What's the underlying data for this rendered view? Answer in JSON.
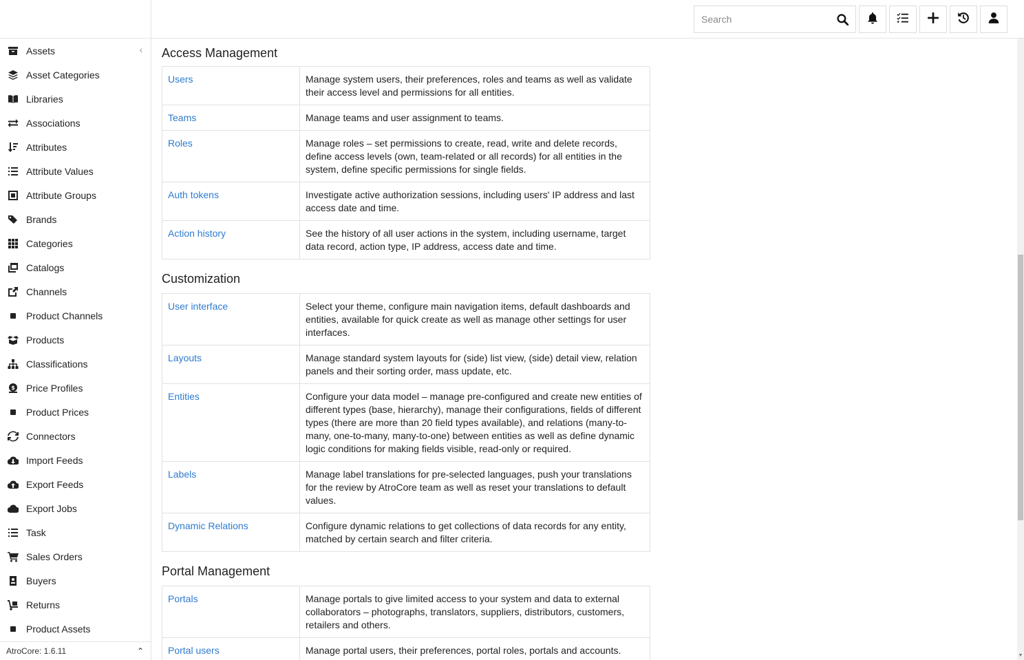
{
  "sidebar": {
    "items": [
      {
        "label": "Assets",
        "icon": "archive-icon"
      },
      {
        "label": "Asset Categories",
        "icon": "layers-icon"
      },
      {
        "label": "Libraries",
        "icon": "book-icon"
      },
      {
        "label": "Associations",
        "icon": "exchange-icon"
      },
      {
        "label": "Attributes",
        "icon": "sort-icon"
      },
      {
        "label": "Attribute Values",
        "icon": "list-icon"
      },
      {
        "label": "Attribute Groups",
        "icon": "group-icon"
      },
      {
        "label": "Brands",
        "icon": "tags-icon"
      },
      {
        "label": "Categories",
        "icon": "grid-icon"
      },
      {
        "label": "Catalogs",
        "icon": "windows-icon"
      },
      {
        "label": "Channels",
        "icon": "share-icon"
      },
      {
        "label": "Product Channels",
        "icon": "square-icon"
      },
      {
        "label": "Products",
        "icon": "box-open-icon"
      },
      {
        "label": "Classifications",
        "icon": "sitemap-icon"
      },
      {
        "label": "Price Profiles",
        "icon": "money-icon"
      },
      {
        "label": "Product Prices",
        "icon": "square-icon"
      },
      {
        "label": "Connectors",
        "icon": "sync-icon"
      },
      {
        "label": "Import Feeds",
        "icon": "cloud-download-icon"
      },
      {
        "label": "Export Feeds",
        "icon": "cloud-upload-icon"
      },
      {
        "label": "Export Jobs",
        "icon": "cloud-icon"
      },
      {
        "label": "Task",
        "icon": "tasks-icon"
      },
      {
        "label": "Sales Orders",
        "icon": "cart-icon"
      },
      {
        "label": "Buyers",
        "icon": "id-badge-icon"
      },
      {
        "label": "Returns",
        "icon": "dolly-icon"
      },
      {
        "label": "Product Assets",
        "icon": "square-icon"
      }
    ],
    "footer": "AtroCore: 1.6.11"
  },
  "header": {
    "search_placeholder": "Search"
  },
  "sections": [
    {
      "title": "Access Management",
      "rows": [
        {
          "name": "Users",
          "desc": "Manage system users, their preferences, roles and teams as well as validate their access level and permissions for all entities."
        },
        {
          "name": "Teams",
          "desc": "Manage teams and user assignment to teams."
        },
        {
          "name": "Roles",
          "desc": "Manage roles – set permissions to create, read, write and delete records, define access levels (own, team-related or all records) for all entities in the system, define specific permissions for single fields."
        },
        {
          "name": "Auth tokens",
          "desc": "Investigate active authorization sessions, including users' IP address and last access date and time."
        },
        {
          "name": "Action history",
          "desc": "See the history of all user actions in the system, including username, target data record, action type, IP address, access date and time."
        }
      ]
    },
    {
      "title": "Customization",
      "rows": [
        {
          "name": "User interface",
          "desc": "Select your theme, configure main navigation items, default dashboards and entities, available for quick create as well as manage other settings for user interfaces."
        },
        {
          "name": "Layouts",
          "desc": "Manage standard system layouts for (side) list view, (side) detail view, relation panels and their sorting order, mass update, etc."
        },
        {
          "name": "Entities",
          "desc": "Configure your data model – manage pre-configured and create new entities of different types (base, hierarchy), manage their configurations, fields of different types (there are more than 20 field types available), and relations (many-to-many, one-to-many, many-to-one) between entities as well as define dynamic logic conditions for making fields visible, read-only or required."
        },
        {
          "name": "Labels",
          "desc": "Manage label translations for pre-selected languages, push your translations for the review by AtroCore team as well as reset your translations to default values."
        },
        {
          "name": "Dynamic Relations",
          "desc": "Configure dynamic relations to get collections of data records for any entity, matched by certain search and filter criteria."
        }
      ]
    },
    {
      "title": "Portal Management",
      "rows": [
        {
          "name": "Portals",
          "desc": "Manage portals to give limited access to your system and data to external collaborators – photographs, translators, suppliers, distributors, customers, retailers and others."
        },
        {
          "name": "Portal users",
          "desc": "Manage portal users, their preferences, portal roles, portals and accounts."
        },
        {
          "name": "",
          "desc": ""
        }
      ]
    }
  ]
}
